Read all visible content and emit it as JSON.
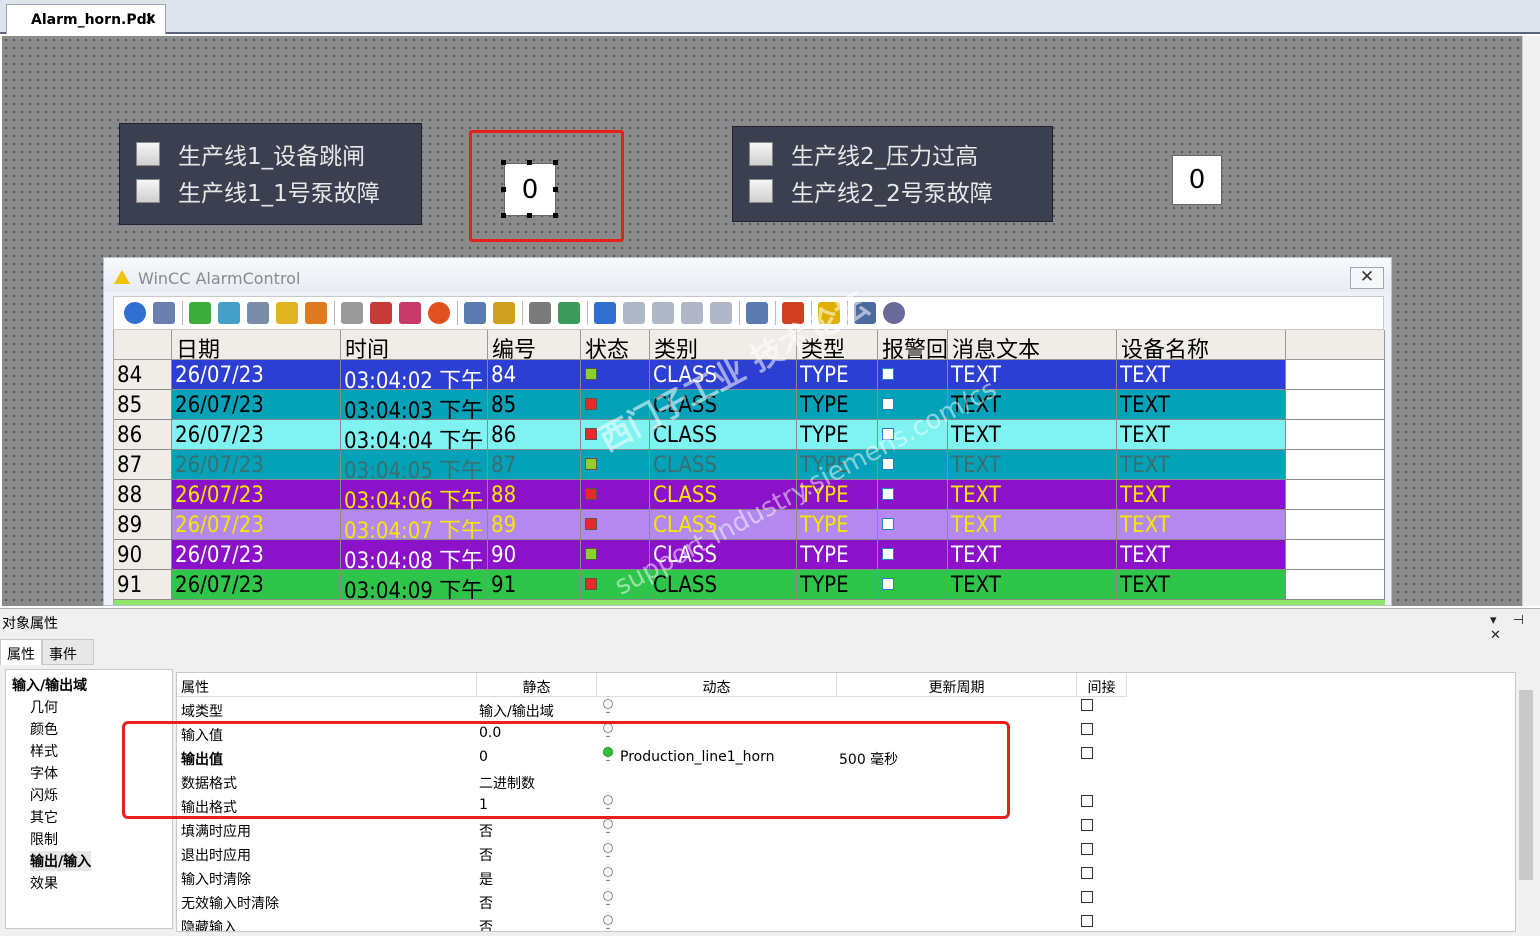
{
  "tab": {
    "title": "Alarm_horn.Pdl",
    "close": "x"
  },
  "panel1": {
    "items": [
      "生产线1_设备跳闸",
      "生产线1_1号泵故障"
    ],
    "value": "0"
  },
  "panel2": {
    "items": [
      "生产线2_压力过高",
      "生产线2_2号泵故障"
    ],
    "value": "0"
  },
  "alarm_control": {
    "title": "WinCC AlarmControl",
    "close": "✕",
    "columns": [
      "日期",
      "时间",
      "编号",
      "状态",
      "类别",
      "类型",
      "报警回",
      "消息文本",
      "设备名称"
    ],
    "rows": [
      {
        "num": "84",
        "date": "26/07/23",
        "time": "03:04:02 下午",
        "id": "84",
        "cls": "CLASS",
        "type": "TYPE",
        "text": "TEXT",
        "dev": "TEXT",
        "bg": "#2d3fd3",
        "fg": "#ffffff",
        "st": "#8bd12c"
      },
      {
        "num": "85",
        "date": "26/07/23",
        "time": "03:04:03 下午",
        "id": "85",
        "cls": "CLASS",
        "type": "TYPE",
        "text": "TEXT",
        "dev": "TEXT",
        "bg": "#03a2b8",
        "fg": "#000000",
        "st": "#e62a2a"
      },
      {
        "num": "86",
        "date": "26/07/23",
        "time": "03:04:04 下午",
        "id": "86",
        "cls": "CLASS",
        "type": "TYPE",
        "text": "TEXT",
        "dev": "TEXT",
        "bg": "#7ff2f2",
        "fg": "#000000",
        "st": "#e62a2a"
      },
      {
        "num": "87",
        "date": "26/07/23",
        "time": "03:04:05 下午",
        "id": "87",
        "cls": "CLASS",
        "type": "TYPE",
        "text": "TEXT",
        "dev": "TEXT",
        "bg": "#03a2b8",
        "fg": "#3b6f6f",
        "st": "#8bd12c"
      },
      {
        "num": "88",
        "date": "26/07/23",
        "time": "03:04:06 下午",
        "id": "88",
        "cls": "CLASS",
        "type": "TYPE",
        "text": "TEXT",
        "dev": "TEXT",
        "bg": "#8b12c9",
        "fg": "#f7e600",
        "st": "#e62a2a"
      },
      {
        "num": "89",
        "date": "26/07/23",
        "time": "03:04:07 下午",
        "id": "89",
        "cls": "CLASS",
        "type": "TYPE",
        "text": "TEXT",
        "dev": "TEXT",
        "bg": "#b389f0",
        "fg": "#f7e600",
        "st": "#e62a2a"
      },
      {
        "num": "90",
        "date": "26/07/23",
        "time": "03:04:08 下午",
        "id": "90",
        "cls": "CLASS",
        "type": "TYPE",
        "text": "TEXT",
        "dev": "TEXT",
        "bg": "#8b12c9",
        "fg": "#ffffff",
        "st": "#8bd12c"
      },
      {
        "num": "91",
        "date": "26/07/23",
        "time": "03:04:09 下午",
        "id": "91",
        "cls": "CLASS",
        "type": "TYPE",
        "text": "TEXT",
        "dev": "TEXT",
        "bg": "#2ec54a",
        "fg": "#000000",
        "st": "#e62a2a"
      }
    ]
  },
  "watermark": {
    "line1": "西门子工业 技术论坛",
    "line2": "support.industry.siemens.com/cs"
  },
  "props": {
    "title": "对象属性",
    "controls": "▾ ⊣ ✕",
    "tabs": [
      "属性",
      "事件"
    ],
    "tree": {
      "root": "输入/输出域",
      "children": [
        "几何",
        "颜色",
        "样式",
        "字体",
        "闪烁",
        "其它",
        "限制",
        "输出/输入",
        "效果"
      ]
    },
    "headers": [
      "属性",
      "静态",
      "动态",
      "更新周期",
      "间接"
    ],
    "rows": [
      {
        "name": "域类型",
        "static": "输入/输出域",
        "dynamic": "",
        "cycle": "",
        "bulb": true,
        "bulb_on": false,
        "chk": true,
        "bold": false
      },
      {
        "name": "输入值",
        "static": "0.0",
        "dynamic": "",
        "cycle": "",
        "bulb": true,
        "bulb_on": false,
        "chk": true,
        "bold": false
      },
      {
        "name": "输出值",
        "static": "0",
        "dynamic": "Production_line1_horn",
        "cycle": "500 毫秒",
        "bulb": true,
        "bulb_on": true,
        "chk": true,
        "bold": true
      },
      {
        "name": "数据格式",
        "static": "二进制数",
        "dynamic": "",
        "cycle": "",
        "bulb": false,
        "bulb_on": false,
        "chk": false,
        "bold": false
      },
      {
        "name": "输出格式",
        "static": "1",
        "dynamic": "",
        "cycle": "",
        "bulb": true,
        "bulb_on": false,
        "chk": true,
        "bold": false
      },
      {
        "name": "填满时应用",
        "static": "否",
        "dynamic": "",
        "cycle": "",
        "bulb": true,
        "bulb_on": false,
        "chk": true,
        "bold": false
      },
      {
        "name": "退出时应用",
        "static": "否",
        "dynamic": "",
        "cycle": "",
        "bulb": true,
        "bulb_on": false,
        "chk": true,
        "bold": false
      },
      {
        "name": "输入时清除",
        "static": "是",
        "dynamic": "",
        "cycle": "",
        "bulb": true,
        "bulb_on": false,
        "chk": true,
        "bold": false
      },
      {
        "name": "无效输入时清除",
        "static": "否",
        "dynamic": "",
        "cycle": "",
        "bulb": true,
        "bulb_on": false,
        "chk": true,
        "bold": false
      },
      {
        "name": "隐藏输入",
        "static": "否",
        "dynamic": "",
        "cycle": "",
        "bulb": true,
        "bulb_on": false,
        "chk": true,
        "bold": false
      }
    ]
  },
  "colors": {
    "highlight": "#e8201c",
    "panel": "#3b3f4f"
  }
}
